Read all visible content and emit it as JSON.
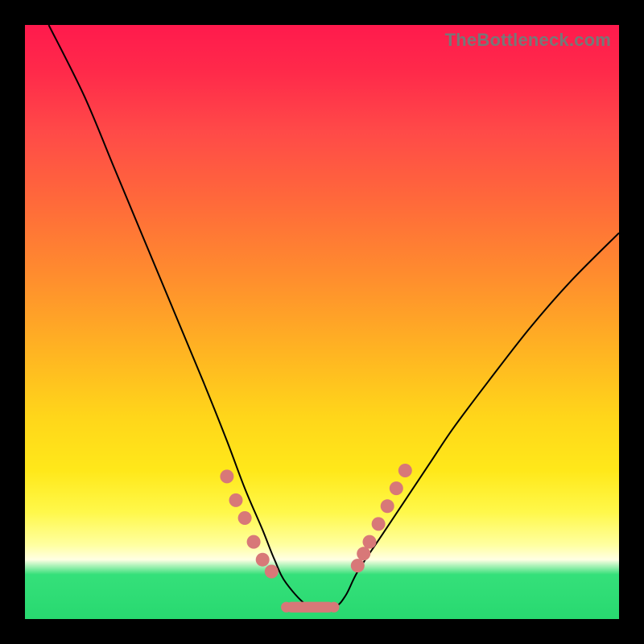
{
  "watermark": "TheBottleneck.com",
  "colors": {
    "background": "#000000",
    "gradient_top": "#ff1a4d",
    "gradient_mid": "#ffd61a",
    "gradient_bottom": "#28d970",
    "curve": "#000000",
    "marker": "#d87878"
  },
  "chart_data": {
    "type": "line",
    "title": "",
    "xlabel": "",
    "ylabel": "",
    "x_range": [
      0,
      100
    ],
    "y_range": [
      0,
      100
    ],
    "series": [
      {
        "name": "bottleneck-curve",
        "x": [
          4,
          10,
          15,
          20,
          25,
          30,
          34,
          37,
          40,
          42,
          44,
          48,
          52,
          54,
          56,
          60,
          64,
          68,
          72,
          78,
          85,
          92,
          100
        ],
        "values": [
          100,
          88,
          76,
          64,
          52,
          40,
          30,
          22,
          15,
          10,
          6,
          2,
          2,
          4,
          8,
          14,
          20,
          26,
          32,
          40,
          49,
          57,
          65
        ]
      }
    ],
    "markers_left": [
      {
        "x": 34,
        "y": 24
      },
      {
        "x": 35.5,
        "y": 20
      },
      {
        "x": 37,
        "y": 17
      },
      {
        "x": 38.5,
        "y": 13
      },
      {
        "x": 40,
        "y": 10
      },
      {
        "x": 41.5,
        "y": 8
      }
    ],
    "markers_right": [
      {
        "x": 56,
        "y": 9
      },
      {
        "x": 57,
        "y": 11
      },
      {
        "x": 58,
        "y": 13
      },
      {
        "x": 59.5,
        "y": 16
      },
      {
        "x": 61,
        "y": 19
      },
      {
        "x": 62.5,
        "y": 22
      },
      {
        "x": 64,
        "y": 25
      }
    ],
    "flat_segment": {
      "x_start": 44,
      "x_end": 52,
      "y": 2,
      "thickness_pct": 1.8
    }
  }
}
